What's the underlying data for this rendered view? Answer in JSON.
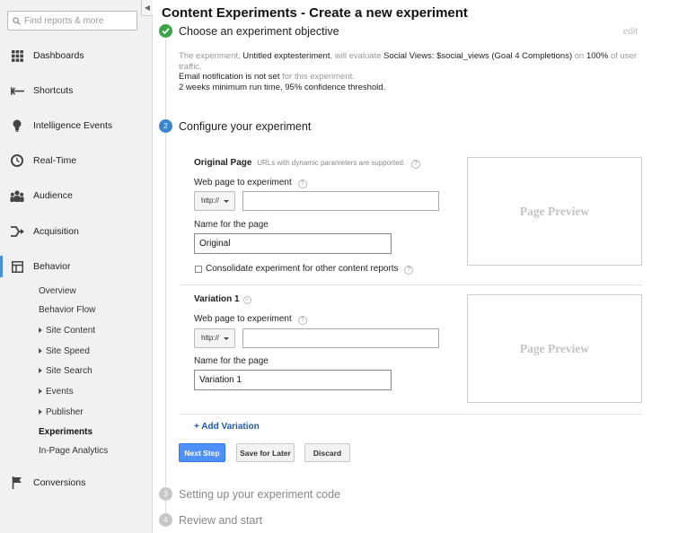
{
  "sidebar": {
    "search_placeholder": "Find reports & more",
    "nav": [
      {
        "label": "Dashboards"
      },
      {
        "label": "Shortcuts"
      },
      {
        "label": "Intelligence Events"
      },
      {
        "label": "Real-Time"
      },
      {
        "label": "Audience"
      },
      {
        "label": "Acquisition"
      },
      {
        "label": "Behavior"
      },
      {
        "label": "Conversions"
      }
    ],
    "behavior_sub": [
      {
        "label": "Overview"
      },
      {
        "label": "Behavior Flow"
      },
      {
        "label": "Site Content"
      },
      {
        "label": "Site Speed"
      },
      {
        "label": "Site Search"
      },
      {
        "label": "Events"
      },
      {
        "label": "Publisher"
      },
      {
        "label": "Experiments"
      },
      {
        "label": "In-Page Analytics"
      }
    ]
  },
  "main": {
    "title": "Content Experiments - Create a new experiment",
    "step1": {
      "title": "Choose an experiment objective",
      "edit": "edit",
      "summary": {
        "p1": "The experiment,",
        "name": "Untitled exptesteriment",
        "p2": ", will evaluate",
        "objective": "Social Views: $social_views (Goal 4 Completions)",
        "p3": "on",
        "traffic": "100%",
        "p4": "of user traffic.",
        "email": "Email notification is not set",
        "email_suffix": "for this experiment.",
        "runtime": "2 weeks minimum run time, 95% confidence threshold."
      }
    },
    "step2": {
      "number": "2",
      "title": "Configure your experiment",
      "original": {
        "heading": "Original Page",
        "hint": "URLs with dynamic parameters are supported.",
        "url_label": "Web page to experiment",
        "protocol": "http://",
        "url_value": "",
        "name_label": "Name for the page",
        "name_value": "Original",
        "checkbox_label": "Consolidate experiment for other content reports",
        "preview": "Page Preview"
      },
      "variation": {
        "heading": "Variation 1",
        "url_label": "Web page to experiment",
        "protocol": "http://",
        "url_value": "",
        "name_label": "Name for the page",
        "name_value": "Variation 1",
        "preview": "Page Preview"
      },
      "add_variation": "+ Add Variation",
      "buttons": {
        "next": "Next Step",
        "save": "Save for Later",
        "discard": "Discard"
      }
    },
    "step3": {
      "number": "3",
      "title": "Setting up your experiment code"
    },
    "step4": {
      "number": "4",
      "title": "Review and start"
    }
  },
  "colors": {
    "done": "#3aa547",
    "current": "#3a87d0",
    "pending": "#c7c7c7",
    "primary_button": "#4d90fe",
    "link": "#1f5aa8"
  }
}
